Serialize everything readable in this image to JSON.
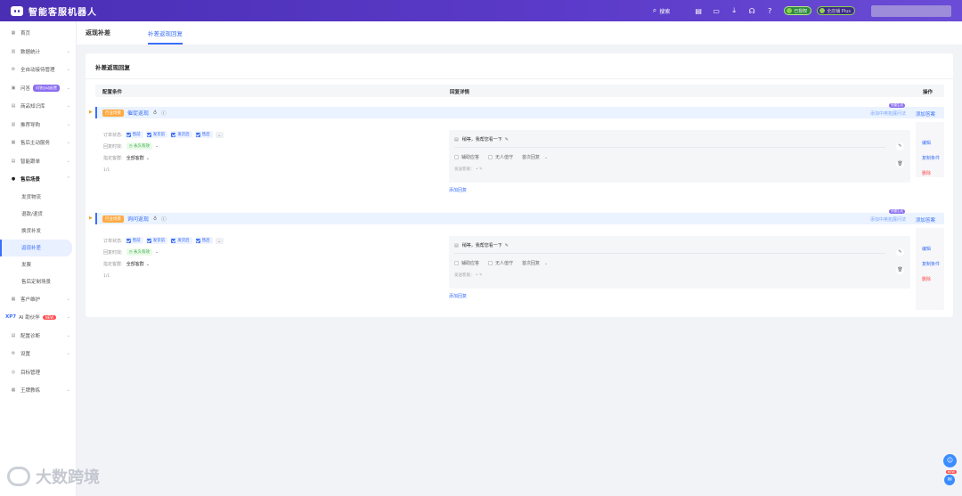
{
  "header": {
    "app_title": "智能客服机器人",
    "search_label": "搜索",
    "pill_status": "已授权",
    "pill_plan": "全店铺 Plus"
  },
  "sidebar": {
    "items": [
      {
        "label": "首页",
        "chev": false
      },
      {
        "label": "数据统计",
        "chev": true
      },
      {
        "label": "全自动接待管理",
        "chev": true
      },
      {
        "label": "问答",
        "badge": "问答自动配置",
        "chev": true
      },
      {
        "label": "商品知识库",
        "chev": true
      },
      {
        "label": "推荐导购",
        "chev": true
      },
      {
        "label": "售后主动服务",
        "chev": true
      },
      {
        "label": "智能跟单",
        "chev": true
      },
      {
        "label": "售后场景",
        "chev": true,
        "expanded": true
      }
    ],
    "sub_items": [
      "发货物流",
      "退款/退货",
      "换货补发",
      "返现补差",
      "发票",
      "售后定制场景"
    ],
    "active_sub": "返现补差",
    "items_after": [
      {
        "label": "客户维护",
        "chev": true
      },
      {
        "label": "AI 助伙伴",
        "prefix": "XP7",
        "badge_red": "NEW",
        "chev": true
      },
      {
        "label": "配置诊断",
        "chev": true
      },
      {
        "label": "设置",
        "chev": true
      },
      {
        "label": "目标管理",
        "chev": false
      },
      {
        "label": "王牌教练",
        "chev": true
      }
    ]
  },
  "tabs": {
    "main": "返现补差",
    "sub": "补差返现回复"
  },
  "card": {
    "title": "补差返现回复",
    "col_config": "配置条件",
    "col_reply": "回复详情",
    "col_ops": "操作"
  },
  "rules": [
    {
      "tag": "行业场景",
      "name": "催促返现",
      "add_ref": "添加中英拓展问法",
      "add_ref_badge": "快捷生成",
      "add_answer": "添加答案",
      "order_status_label": "订单状态:",
      "statuses": [
        "售前",
        "发货前",
        "发货后",
        "售后"
      ],
      "reply_time_label": "回复时效:",
      "reply_time": "永久有效",
      "shop_label": "指定客群:",
      "shop_value": "全部客群",
      "pager": "1/1",
      "reply_text": "稍等，我帮您看一下",
      "opt_assist": "辅助应答",
      "opt_unmanned": "无人值守",
      "opt_first": "首次回复",
      "send_kf": "发送客服：",
      "add_reply": "添加回复",
      "op_edit": "编辑",
      "op_copy": "复制条件",
      "op_delete": "删除"
    },
    {
      "tag": "行业场景",
      "name": "询问返现",
      "add_ref": "添加中英拓展问法",
      "add_ref_badge": "快捷生成",
      "add_answer": "添加答案",
      "order_status_label": "订单状态:",
      "statuses": [
        "售前",
        "发货前",
        "发货后",
        "售后"
      ],
      "reply_time_label": "回复时效:",
      "reply_time": "永久有效",
      "shop_label": "指定客群:",
      "shop_value": "全部客群",
      "pager": "1/1",
      "reply_text": "稍等，我帮您看一下",
      "opt_assist": "辅助应答",
      "opt_unmanned": "无人值守",
      "opt_first": "首次回复",
      "send_kf": "发送客服：",
      "add_reply": "添加回复",
      "op_edit": "编辑",
      "op_copy": "复制条件",
      "op_delete": "删除"
    }
  ],
  "watermark": "大数跨境",
  "float_new": "NEW",
  "icons": {
    "search": "search-icon",
    "doc": "document-icon",
    "screen": "screen-icon",
    "download": "download-icon",
    "headset": "headset-icon",
    "help": "help-icon"
  }
}
